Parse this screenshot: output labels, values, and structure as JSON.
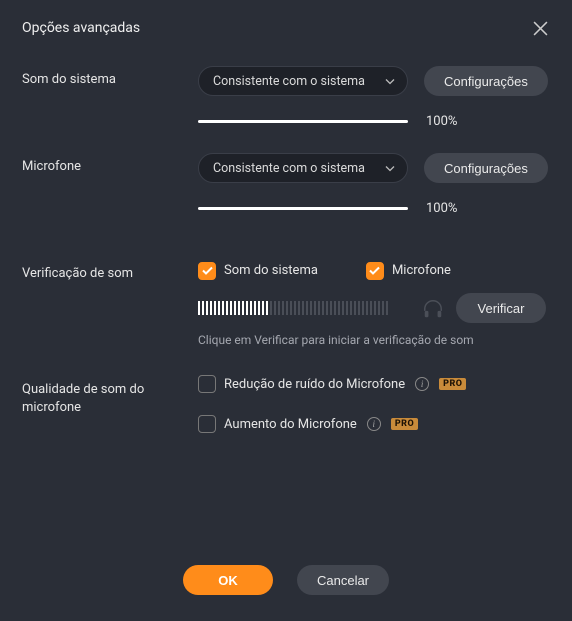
{
  "dialog": {
    "title": "Opções avançadas"
  },
  "systemSound": {
    "label": "Som do sistema",
    "selectValue": "Consistente com o sistema",
    "settingsBtn": "Configurações",
    "volume": "100%"
  },
  "microphone": {
    "label": "Microfone",
    "selectValue": "Consistente com o sistema",
    "settingsBtn": "Configurações",
    "volume": "100%"
  },
  "soundCheck": {
    "label": "Verificação de som",
    "systemCheckbox": "Som do sistema",
    "micCheckbox": "Microfone",
    "verifyBtn": "Verificar",
    "hint": "Clique em Verificar para iniciar a verificação de som"
  },
  "micQuality": {
    "label": "Qualidade de som do microfone",
    "noiseReduction": "Redução de ruído do Microfone",
    "micBoost": "Aumento do Microfone",
    "proBadge": "PRO"
  },
  "footer": {
    "ok": "OK",
    "cancel": "Cancelar"
  }
}
